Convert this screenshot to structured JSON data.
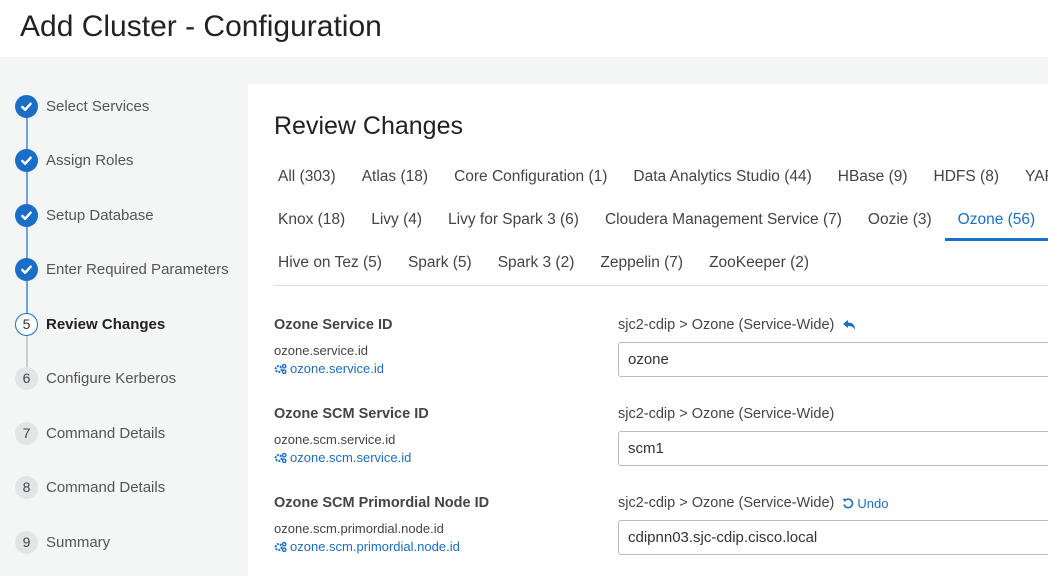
{
  "header": {
    "title": "Add Cluster - Configuration"
  },
  "steps": [
    {
      "num": "1",
      "label": "Select Services",
      "state": "done"
    },
    {
      "num": "2",
      "label": "Assign Roles",
      "state": "done"
    },
    {
      "num": "3",
      "label": "Setup Database",
      "state": "done"
    },
    {
      "num": "4",
      "label": "Enter Required Parameters",
      "state": "done"
    },
    {
      "num": "5",
      "label": "Review Changes",
      "state": "current"
    },
    {
      "num": "6",
      "label": "Configure Kerberos",
      "state": "todo"
    },
    {
      "num": "7",
      "label": "Command Details",
      "state": "todo"
    },
    {
      "num": "8",
      "label": "Command Details",
      "state": "todo"
    },
    {
      "num": "9",
      "label": "Summary",
      "state": "todo"
    }
  ],
  "main": {
    "title": "Review Changes",
    "tab_rows": [
      [
        "All (303)",
        "Atlas (18)",
        "Core Configuration (1)",
        "Data Analytics Studio (44)",
        "HBase (9)",
        "HDFS (8)",
        "YARN ("
      ],
      [
        "Knox (18)",
        "Livy (4)",
        "Livy for Spark 3 (6)",
        "Cloudera Management Service (7)",
        "Oozie (3)",
        "Ozone (56)",
        "YA"
      ],
      [
        "Hive on Tez (5)",
        "Spark (5)",
        "Spark 3 (2)",
        "Zeppelin (7)",
        "ZooKeeper (2)"
      ]
    ],
    "active_tab": "Ozone (56)",
    "properties": [
      {
        "name": "Ozone Service ID",
        "key": "ozone.service.id",
        "link": "ozone.service.id",
        "scope": "sjc2-cdip > Ozone (Service-Wide)",
        "action": "revert-icon",
        "action_label": "",
        "value": "ozone"
      },
      {
        "name": "Ozone SCM Service ID",
        "key": "ozone.scm.service.id",
        "link": "ozone.scm.service.id",
        "scope": "sjc2-cdip > Ozone (Service-Wide)",
        "action": "",
        "action_label": "",
        "value": "scm1"
      },
      {
        "name": "Ozone SCM Primordial Node ID",
        "key": "ozone.scm.primordial.node.id",
        "link": "ozone.scm.primordial.node.id",
        "scope": "sjc2-cdip > Ozone (Service-Wide)",
        "action": "undo-icon",
        "action_label": "Undo",
        "value": "cdipnn03.sjc-cdip.cisco.local"
      }
    ]
  },
  "colors": {
    "accent": "#1a6ec5"
  }
}
